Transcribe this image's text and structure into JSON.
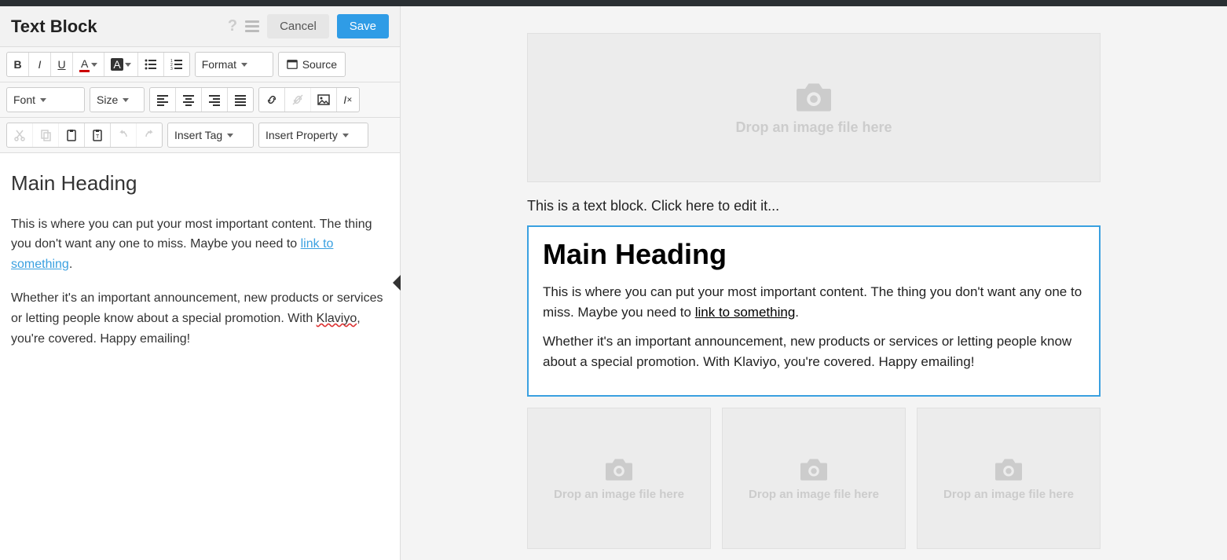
{
  "header": {
    "title": "Text Block",
    "cancel": "Cancel",
    "save": "Save"
  },
  "toolbar": {
    "format": "Format",
    "source": "Source",
    "font": "Font",
    "size": "Size",
    "insert_tag": "Insert Tag",
    "insert_property": "Insert Property"
  },
  "editor": {
    "heading": "Main Heading",
    "p1_a": "This is where you can put your most important content. The thing you don't want any one to miss. Maybe you need to ",
    "p1_link": "link to something",
    "p1_b": ".",
    "p2_a": "Whether it's an important announcement, new products or services or letting people know about a special promotion. With ",
    "p2_spell": "Klaviyo",
    "p2_b": ", you're covered. Happy emailing!"
  },
  "preview": {
    "drop_text": "Drop an image file here",
    "text_block_placeholder": "This is a text block. Click here to edit it...",
    "heading": "Main Heading",
    "p1_a": "This is where you can put your most important content. The thing you don't want any one to miss. Maybe you need to ",
    "p1_link": "link to something",
    "p1_b": ".",
    "p2": "Whether it's an important announcement, new products or services or letting people know about a special promotion. With Klaviyo, you're covered. Happy emailing!"
  }
}
